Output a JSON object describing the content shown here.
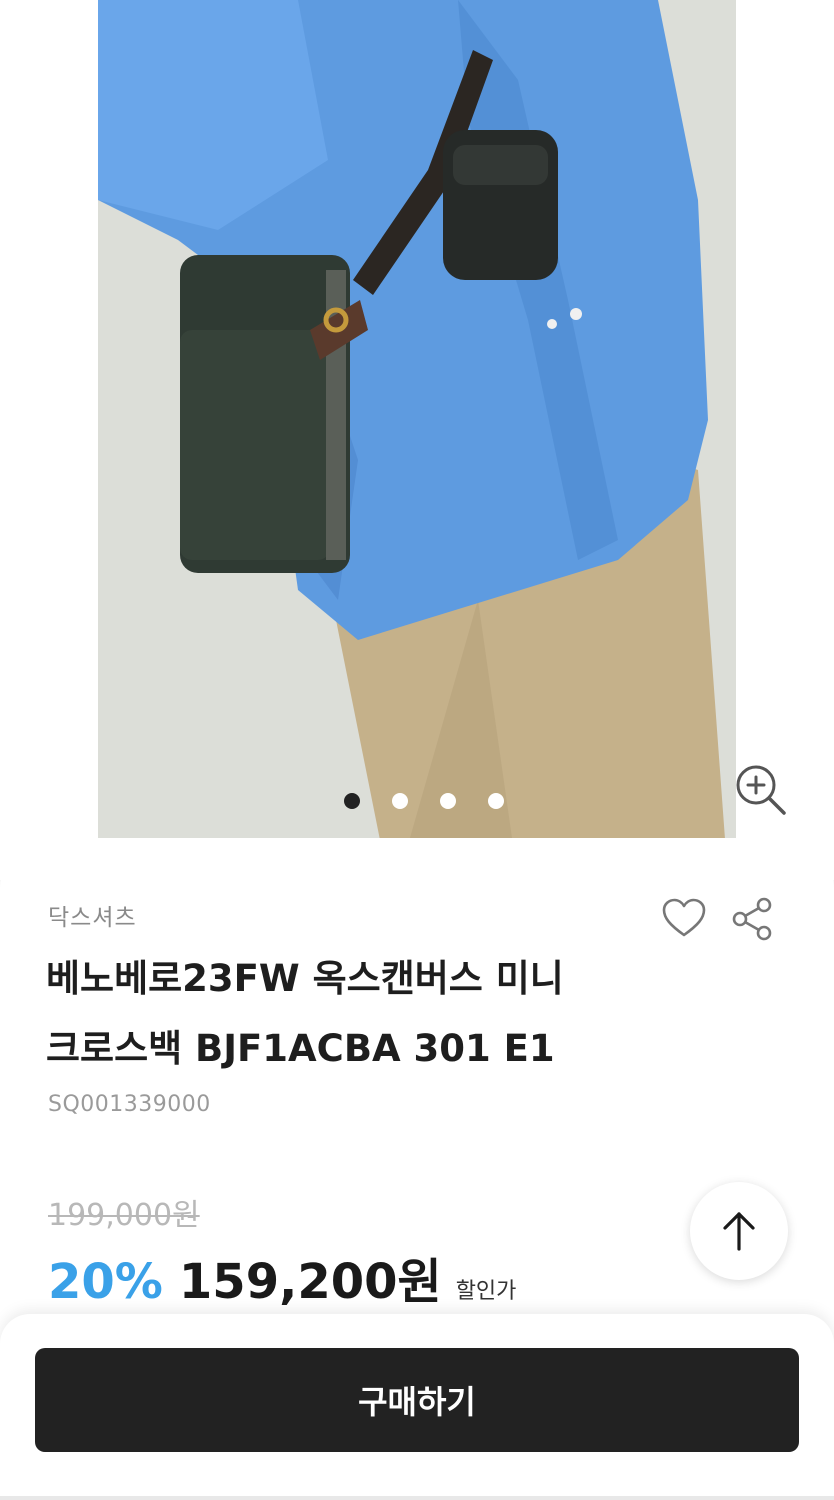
{
  "product": {
    "brand": "닥스셔츠",
    "title_line1": "베노베로23FW 옥스캔버스 미니",
    "title_line2": "크로스백 BJF1ACBA 301 E1",
    "sku": "SQ001339000",
    "original_price": "199,000원",
    "discount_rate": "20%",
    "sale_price": "159,200원",
    "sale_label": "할인가"
  },
  "gallery": {
    "image_count": 4,
    "active_index": 0,
    "image_alt": "product-photo-model-with-crossbag"
  },
  "actions": {
    "buy_label": "구매하기"
  },
  "icons": {
    "zoom": "zoom-in-icon",
    "like": "heart-icon",
    "share": "share-icon",
    "scroll_top": "arrow-up-icon"
  },
  "colors": {
    "discount": "#3aa1e8",
    "buy_button": "#222222",
    "shirt": "#5e9be0",
    "pants": "#c7b38c",
    "bag": "#2f3a33"
  }
}
